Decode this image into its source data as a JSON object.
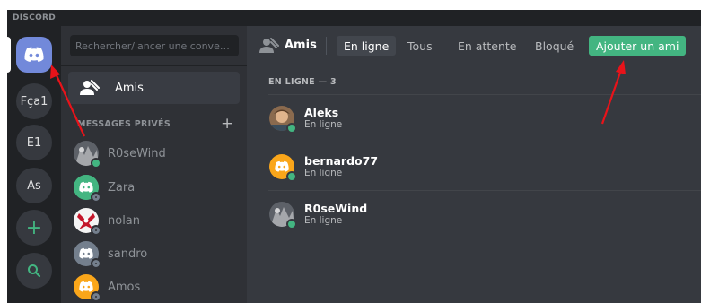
{
  "app": {
    "brand": "DISCORD"
  },
  "guilds": [
    {
      "label": "Fça1"
    },
    {
      "label": "E1"
    },
    {
      "label": "As"
    }
  ],
  "guild_actions": {
    "add": "+",
    "explore": "🔍"
  },
  "dms": {
    "search_placeholder": "Rechercher/lancer une conversat...",
    "friends_label": "Amis",
    "section_header": "MESSAGES PRIVÉS",
    "add_label": "+",
    "items": [
      {
        "name": "R0seWind",
        "status": "online"
      },
      {
        "name": "Zara",
        "status": "offline"
      },
      {
        "name": "nolan",
        "status": "offline"
      },
      {
        "name": "sandro",
        "status": "offline"
      },
      {
        "name": "Amos",
        "status": "offline"
      }
    ]
  },
  "topbar": {
    "title": "Amis",
    "tabs": [
      {
        "label": "En ligne"
      },
      {
        "label": "Tous"
      },
      {
        "label": "En attente"
      },
      {
        "label": "Bloqué"
      }
    ],
    "add_friend": "Ajouter un ami"
  },
  "friends": {
    "header": "EN LIGNE — 3",
    "rows": [
      {
        "name": "Aleks",
        "status": "En ligne"
      },
      {
        "name": "bernardo77",
        "status": "En ligne"
      },
      {
        "name": "R0seWind",
        "status": "En ligne"
      }
    ]
  },
  "colors": {
    "blurple": "#7289da",
    "green": "#43b581",
    "annotation": "#e8131a"
  }
}
